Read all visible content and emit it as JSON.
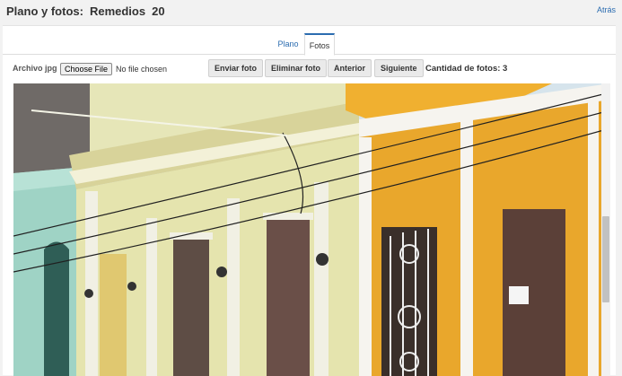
{
  "header": {
    "title_prefix": "Plano y fotos:",
    "entity": "Remedios",
    "number": "20",
    "back_link": "Atrás"
  },
  "tabs": [
    {
      "label": "Plano",
      "active": false
    },
    {
      "label": "Fotos",
      "active": true
    }
  ],
  "toolbar": {
    "file_label": "Archivo jpg",
    "choose_button": "Choose File",
    "file_status": "No file chosen",
    "send_button": "Enviar foto",
    "delete_button": "Eliminar foto",
    "prev_button": "Anterior",
    "next_button": "Siguiente",
    "count_text": "Cantidad de fotos: 3"
  },
  "photo": {
    "subject": "colonial street facades with yellow and orange walls",
    "colors": {
      "sky": "#d9e7f0",
      "mint_wall": "#9fd3c5",
      "cream_wall": "#e8e7b0",
      "orange_wall": "#e8a62a",
      "white_trim": "#f4f4f0",
      "door_brown": "#5b4038"
    }
  },
  "colors": {
    "accent": "#2b6cb0",
    "page_bg": "#f2f2f2"
  }
}
